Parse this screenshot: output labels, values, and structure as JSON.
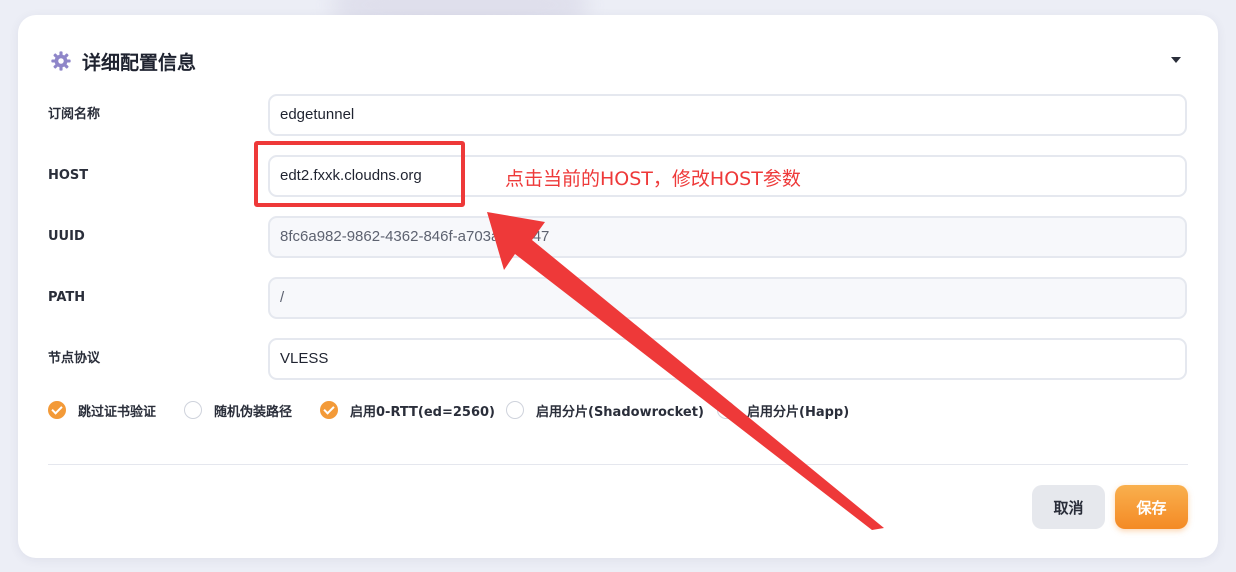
{
  "panel": {
    "title": "详细配置信息",
    "icon": "gear-icon"
  },
  "fields": [
    {
      "key": "name",
      "label": "订阅名称",
      "value": "edgetunnel",
      "readonly": false
    },
    {
      "key": "host",
      "label": "HOST",
      "value": "edt2.fxxk.cloudns.org",
      "readonly": false
    },
    {
      "key": "uuid",
      "label": "UUID",
      "value": "8fc6a982-9862-4362-846f-a703a5a2e47",
      "readonly": true
    },
    {
      "key": "path",
      "label": "PATH",
      "value": "/",
      "readonly": true
    },
    {
      "key": "protocol",
      "label": "节点协议",
      "value": "VLESS",
      "readonly": false
    }
  ],
  "options": [
    {
      "label": "跳过证书验证",
      "checked": true
    },
    {
      "label": "随机伪装路径",
      "checked": false
    },
    {
      "label": "启用0-RTT(ed=2560)",
      "checked": true
    },
    {
      "label": "启用分片(Shadowrocket)",
      "checked": false
    },
    {
      "label": "启用分片(Happ)",
      "checked": false
    }
  ],
  "buttons": {
    "cancel": "取消",
    "save": "保存"
  },
  "annotation": {
    "text": "点击当前的HOST，修改HOST参数",
    "color": "#ee3939"
  },
  "colors": {
    "accent": "#f39a38",
    "annotation": "#ee3939"
  }
}
